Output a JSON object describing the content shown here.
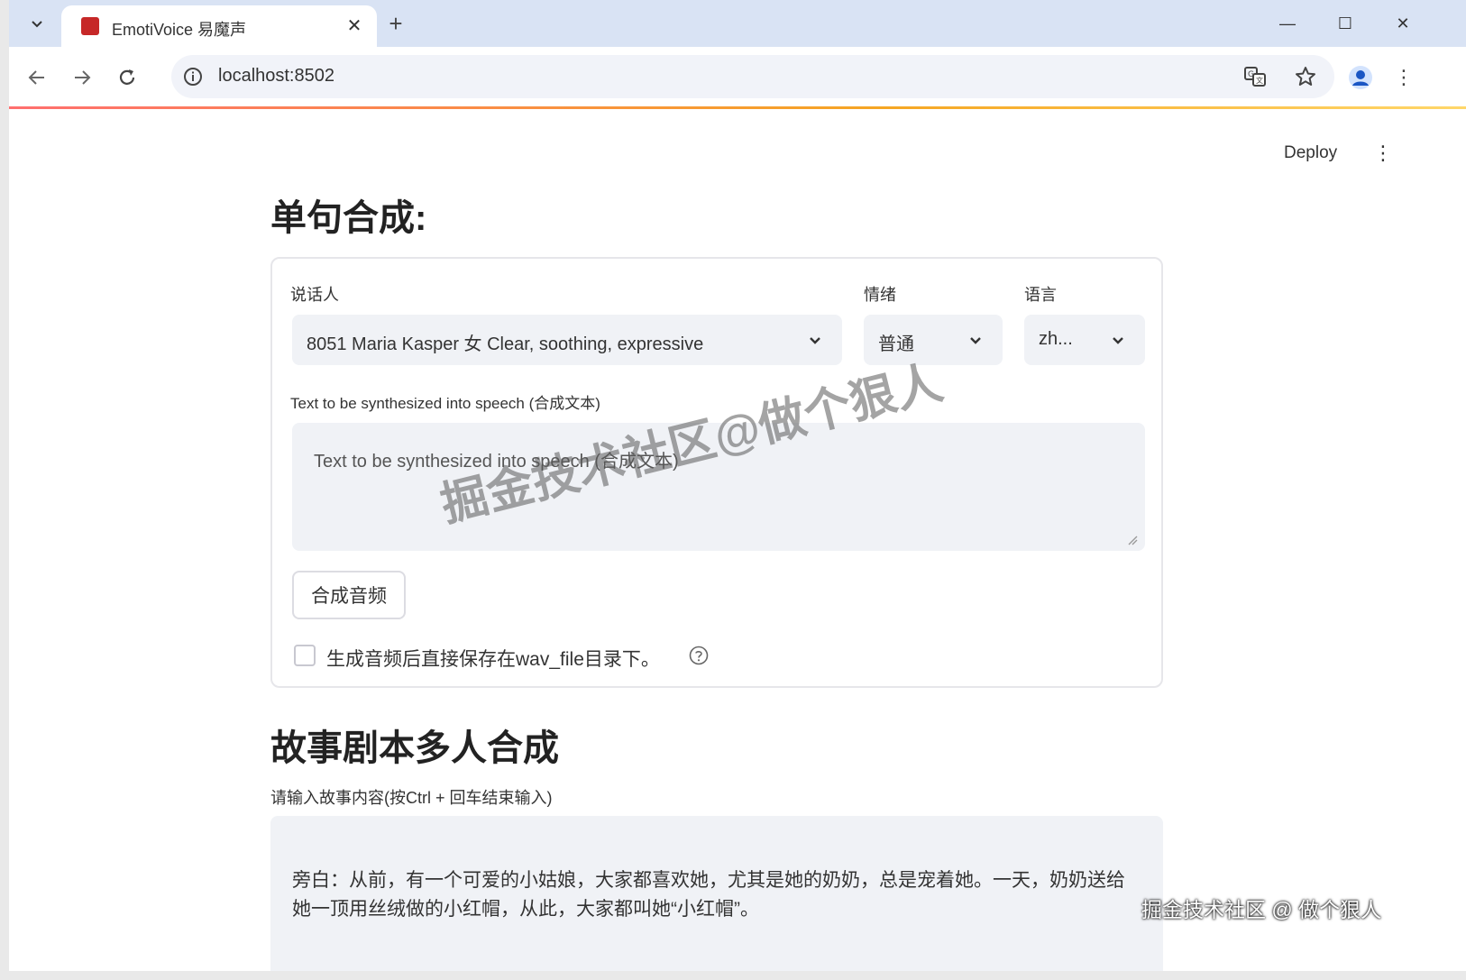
{
  "browser": {
    "tab": {
      "title": "EmotiVoice 易魔声",
      "close": "✕"
    },
    "new_tab": "+",
    "window_controls": {
      "minimize": "—",
      "maximize": "☐",
      "close": "✕"
    },
    "address": "localhost:8502"
  },
  "app": {
    "deploy_label": "Deploy",
    "menu": "⋮"
  },
  "single": {
    "heading": "单句合成:",
    "speaker": {
      "label": "说话人",
      "value": "8051 Maria Kasper 女 Clear, soothing, expressive"
    },
    "emotion": {
      "label": "情绪",
      "value": "普通"
    },
    "language": {
      "label": "语言",
      "value": "zh..."
    },
    "text": {
      "label": "Text to be synthesized into speech (合成文本)",
      "placeholder": "Text to be synthesized into speech (合成文本)"
    },
    "synthesize_button": "合成音频",
    "save_checkbox": {
      "label": "生成音频后直接保存在wav_file目录下。",
      "checked": false
    }
  },
  "story": {
    "heading": "故事剧本多人合成",
    "input_label": "请输入故事内容(按Ctrl + 回车结束输入)",
    "content": "旁白：从前，有一个可爱的小姑娘，大家都喜欢她，尤其是她的奶奶，总是宠着她。一天，奶奶送给她一顶用丝绒做的小红帽，从此，大家都叫她“小红帽”。"
  },
  "watermarks": {
    "center": "掘金技术社区@做个狠人",
    "corner": "掘金技术社区 @ 做个狠人"
  }
}
